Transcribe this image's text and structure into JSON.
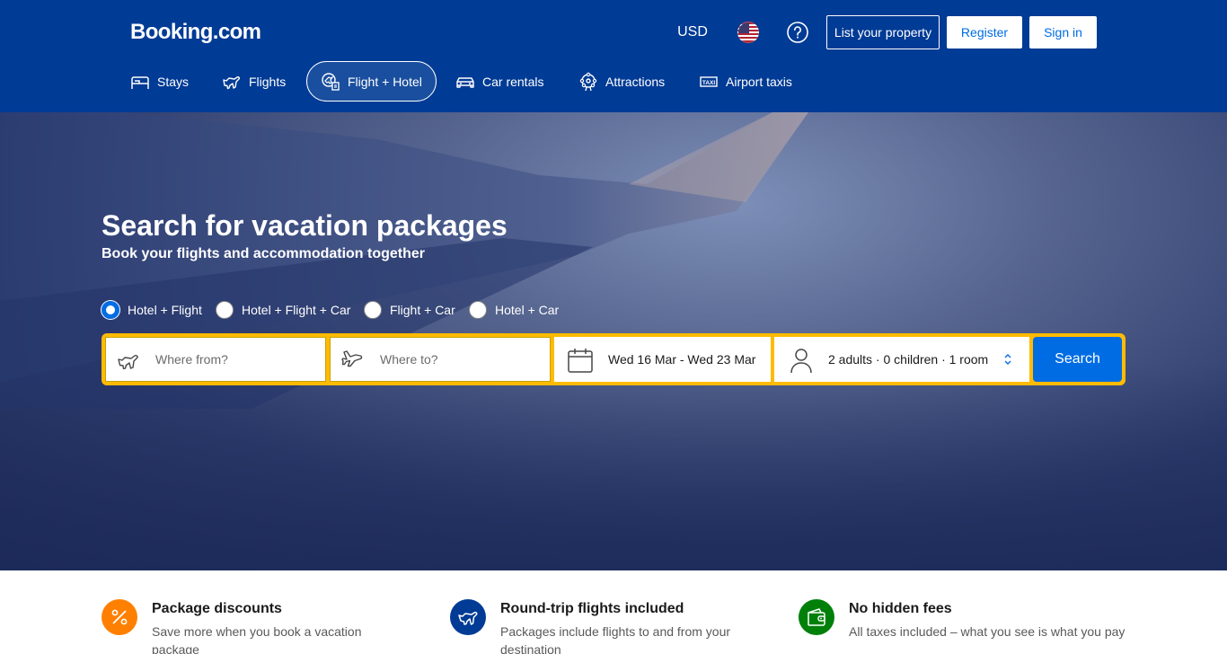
{
  "header": {
    "logo": "Booking.com",
    "currency": "USD",
    "list_property": "List your property",
    "register": "Register",
    "sign_in": "Sign in"
  },
  "nav": [
    {
      "label": "Stays",
      "icon": "bed-icon"
    },
    {
      "label": "Flights",
      "icon": "plane-icon"
    },
    {
      "label": "Flight + Hotel",
      "icon": "flight-hotel-icon",
      "active": true
    },
    {
      "label": "Car rentals",
      "icon": "car-icon"
    },
    {
      "label": "Attractions",
      "icon": "attractions-icon"
    },
    {
      "label": "Airport taxis",
      "icon": "taxi-icon"
    }
  ],
  "hero": {
    "title": "Search for vacation packages",
    "subtitle": "Book your flights and accommodation together"
  },
  "package_options": [
    {
      "label": "Hotel + Flight",
      "checked": true
    },
    {
      "label": "Hotel + Flight + Car",
      "checked": false
    },
    {
      "label": "Flight + Car",
      "checked": false
    },
    {
      "label": "Hotel + Car",
      "checked": false
    }
  ],
  "search": {
    "from_placeholder": "Where from?",
    "to_placeholder": "Where to?",
    "dates": "Wed 16 Mar - Wed 23 Mar",
    "occupancy": "2 adults · 0 children · 1 room",
    "button": "Search"
  },
  "features": [
    {
      "title": "Package discounts",
      "desc": "Save more when you book a vacation package",
      "icon": "percent-icon",
      "color": "#ff8000"
    },
    {
      "title": "Round-trip flights included",
      "desc": "Packages include flights to and from your destination",
      "icon": "plane-icon",
      "color": "#003b95"
    },
    {
      "title": "No hidden fees",
      "desc": "All taxes included – what you see is what you pay",
      "icon": "wallet-icon",
      "color": "#008009"
    }
  ],
  "colors": {
    "brand_blue": "#003b95",
    "action_blue": "#006ce4",
    "search_yellow": "#febb02"
  }
}
